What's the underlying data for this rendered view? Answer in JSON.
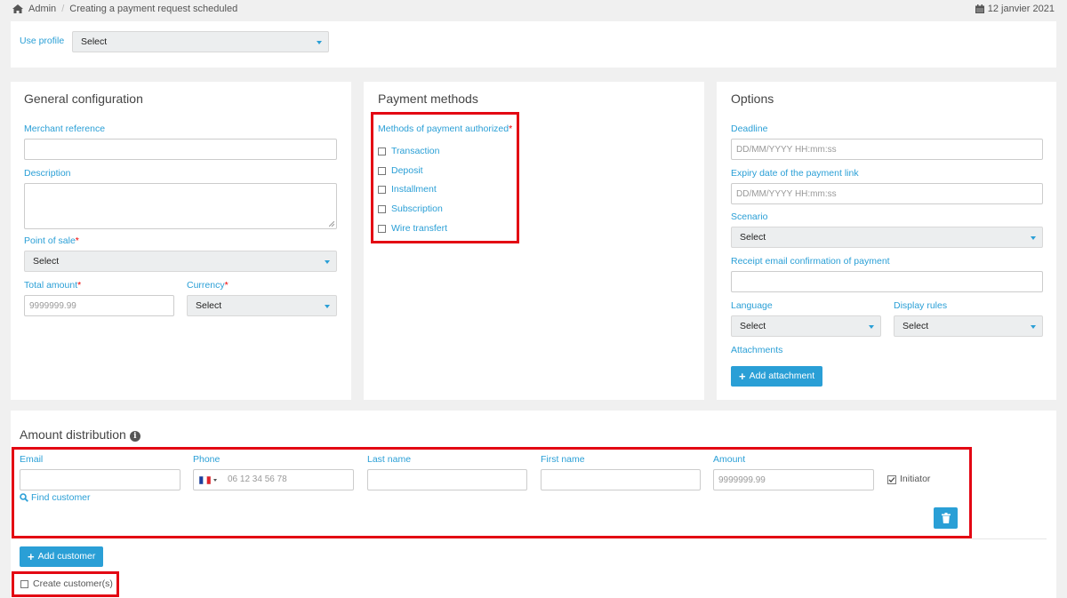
{
  "breadcrumb": {
    "home": "Admin",
    "current": "Creating a payment request scheduled"
  },
  "header_date": "12 janvier 2021",
  "profile": {
    "label": "Use profile",
    "select": "Select"
  },
  "general": {
    "title": "General configuration",
    "merchant_reference": "Merchant reference",
    "description": "Description",
    "point_of_sale": "Point of sale",
    "point_of_sale_value": "Select",
    "total_amount": "Total amount",
    "total_amount_placeholder": "9999999.99",
    "currency": "Currency",
    "currency_value": "Select",
    "required_mark": "*"
  },
  "payment": {
    "title": "Payment methods",
    "methods_label": "Methods of payment authorized",
    "required_mark": "*",
    "methods": [
      "Transaction",
      "Deposit",
      "Installment",
      "Subscription",
      "Wire transfert"
    ]
  },
  "options": {
    "title": "Options",
    "deadline": "Deadline",
    "deadline_placeholder": "DD/MM/YYYY HH:mm:ss",
    "expiry": "Expiry date of the payment link",
    "expiry_placeholder": "DD/MM/YYYY HH:mm:ss",
    "scenario": "Scenario",
    "scenario_value": "Select",
    "receipt": "Receipt email confirmation of payment",
    "language": "Language",
    "language_value": "Select",
    "display_rules": "Display rules",
    "display_rules_value": "Select",
    "attachments": "Attachments",
    "add_attachment": "Add attachment"
  },
  "distribution": {
    "title": "Amount distribution",
    "email": "Email",
    "phone": "Phone",
    "phone_placeholder": "06 12 34 56 78",
    "last_name": "Last name",
    "first_name": "First name",
    "amount": "Amount",
    "amount_placeholder": "9999999.99",
    "initiator": "Initiator",
    "find_customer": "Find customer",
    "add_customer": "Add customer",
    "create_customers": "Create customer(s)"
  },
  "colors": {
    "accent": "#2a9fd6",
    "highlight": "#e30613"
  }
}
